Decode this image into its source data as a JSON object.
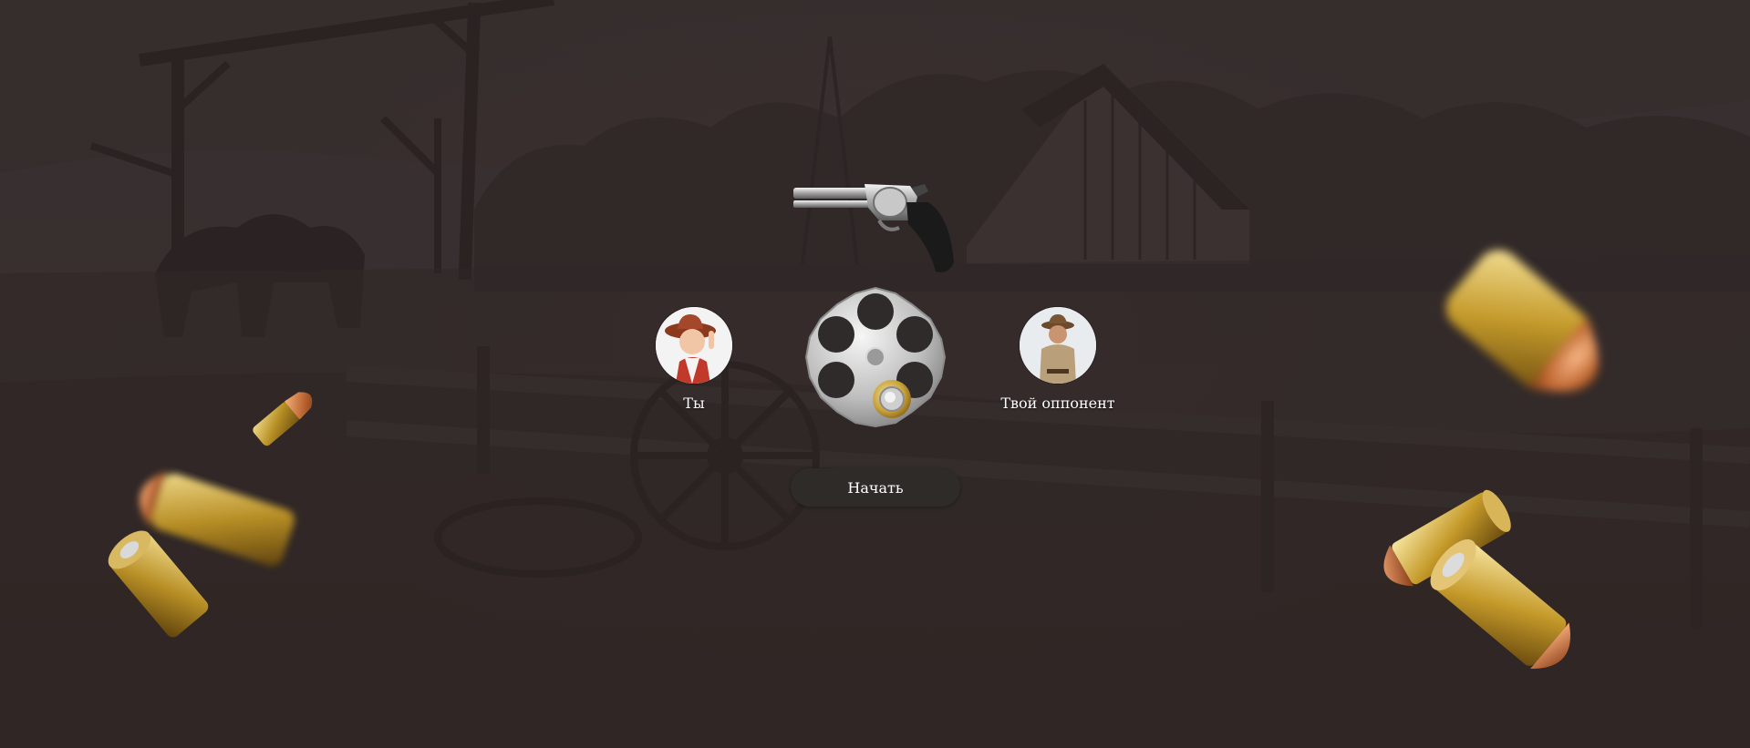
{
  "game": {
    "player": {
      "name": "Ты",
      "avatar_icon": "cowboy-kid-avatar-icon"
    },
    "opponent": {
      "name": "Твой оппонент",
      "avatar_icon": "cowboy-man-avatar-icon"
    },
    "start_button_label": "Начать",
    "revolver_icon": "revolver-icon",
    "cylinder": {
      "chambers_total": 6,
      "chambers_loaded": 1
    }
  },
  "colors": {
    "overlay": "#3a3231",
    "button_bg": "#2f2b29",
    "text": "#ffffff",
    "brass": "#c9a23a",
    "copper": "#c07040"
  }
}
